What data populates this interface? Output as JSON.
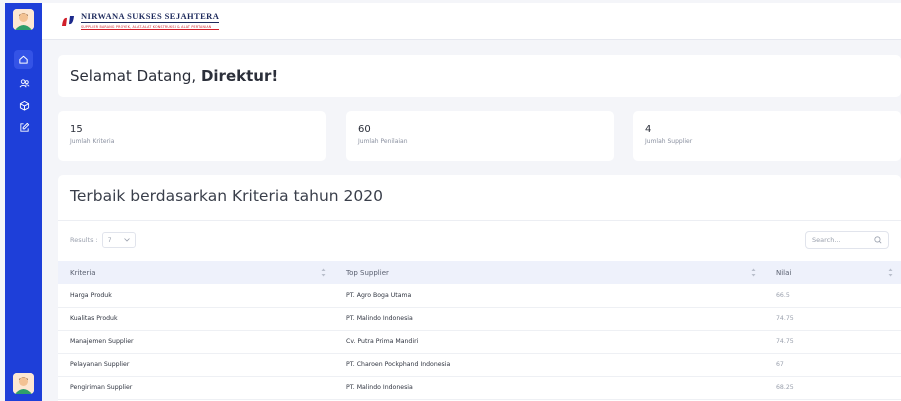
{
  "brand": {
    "title": "NIRWANA SUKSES SEJAHTERA",
    "subtitle": "SUPPLIER BARANG PROYEK, ALAT-ALAT KONSTRUKSI & ALAT PERTANIAN"
  },
  "sidebar": {
    "items": [
      {
        "icon": "home-icon",
        "active": true
      },
      {
        "icon": "users-icon",
        "active": false
      },
      {
        "icon": "box-icon",
        "active": false
      },
      {
        "icon": "edit-icon",
        "active": false
      }
    ]
  },
  "welcome": {
    "greeting": "Selamat Datang,",
    "role": "Direktur!"
  },
  "stats": [
    {
      "value": "15",
      "label": "Jumlah Kriteria"
    },
    {
      "value": "60",
      "label": "Jumlah Penilaian"
    },
    {
      "value": "4",
      "label": "Jumlah Supplier"
    }
  ],
  "section": {
    "title": "Terbaik berdasarkan Kriteria tahun 2020",
    "results_label": "Results :",
    "results_value": "7",
    "search_placeholder": "Search..."
  },
  "table": {
    "headers": [
      "Kriteria",
      "Top Supplier",
      "Nilai"
    ],
    "rows": [
      [
        "Harga Produk",
        "PT. Agro Boga Utama",
        "66.5"
      ],
      [
        "Kualitas Produk",
        "PT. Malindo Indonesia",
        "74.75"
      ],
      [
        "Manajemen Supplier",
        "Cv. Putra Prima Mandiri",
        "74.75"
      ],
      [
        "Pelayanan Supplier",
        "PT. Charoen Pockphand Indonesia",
        "67"
      ],
      [
        "Pengiriman Supplier",
        "PT. Malindo Indonesia",
        "68.25"
      ]
    ]
  },
  "colors": {
    "sidebar": "#1e3fd9",
    "accent_red": "#d11f2a",
    "header_row": "#eef1fb"
  }
}
